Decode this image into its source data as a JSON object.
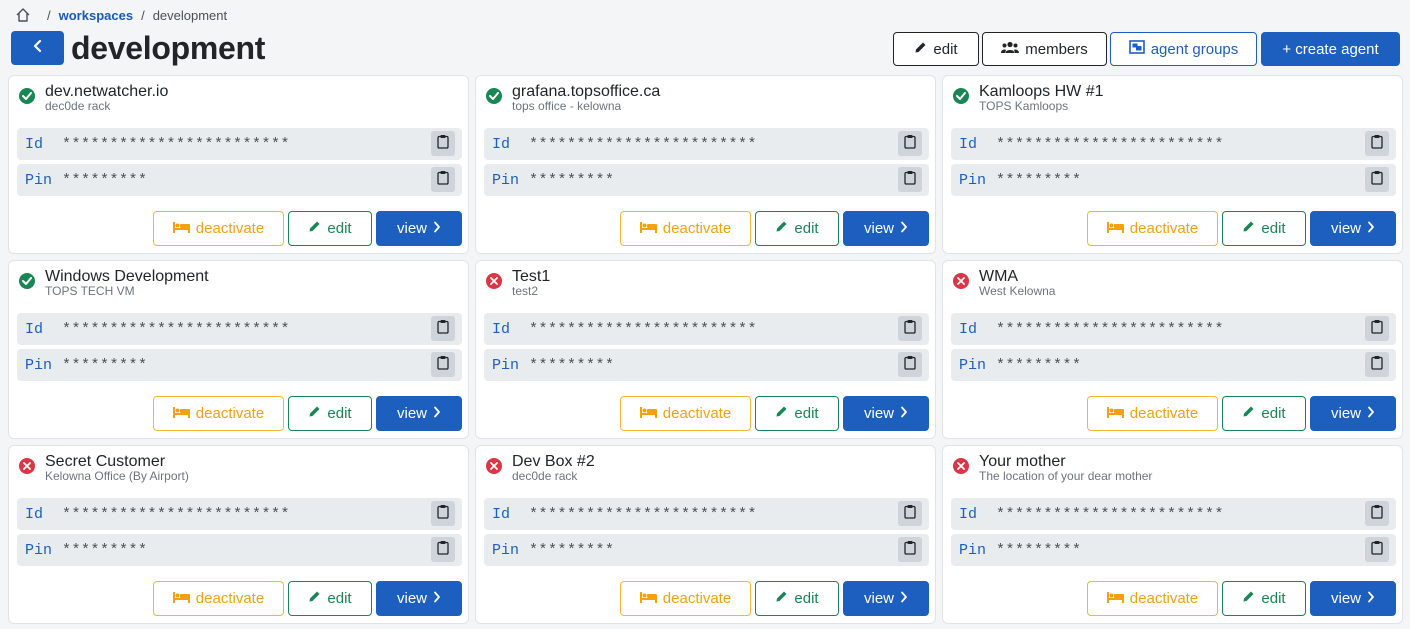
{
  "breadcrumb": {
    "items": [
      "workspaces",
      "development"
    ],
    "separator": "/"
  },
  "header": {
    "title": "development",
    "buttons": {
      "edit": "edit",
      "members": "members",
      "agent_groups": "agent groups",
      "create_agent": "+ create agent"
    }
  },
  "labels": {
    "id": "Id",
    "pin": "Pin",
    "masked_id": "************************",
    "masked_pin": "*********",
    "deactivate": "deactivate",
    "edit": "edit",
    "view": "view"
  },
  "colors": {
    "primary": "#1c5fbf",
    "success": "#198754",
    "danger": "#dc3545",
    "warning": "#f2a20f"
  },
  "agents": [
    {
      "name": "dev.netwatcher.io",
      "subtitle": "dec0de rack",
      "status": "active"
    },
    {
      "name": "grafana.topsoffice.ca",
      "subtitle": "tops office - kelowna",
      "status": "active"
    },
    {
      "name": "Kamloops HW #1",
      "subtitle": "TOPS Kamloops",
      "status": "active"
    },
    {
      "name": "Windows Development",
      "subtitle": "TOPS TECH VM",
      "status": "active"
    },
    {
      "name": "Test1",
      "subtitle": "test2",
      "status": "inactive"
    },
    {
      "name": "WMA",
      "subtitle": "West Kelowna",
      "status": "inactive"
    },
    {
      "name": "Secret Customer",
      "subtitle": "Kelowna Office (By Airport)",
      "status": "inactive"
    },
    {
      "name": "Dev Box #2",
      "subtitle": "dec0de rack",
      "status": "inactive"
    },
    {
      "name": "Your mother",
      "subtitle": "The location of your dear mother",
      "status": "inactive"
    }
  ]
}
